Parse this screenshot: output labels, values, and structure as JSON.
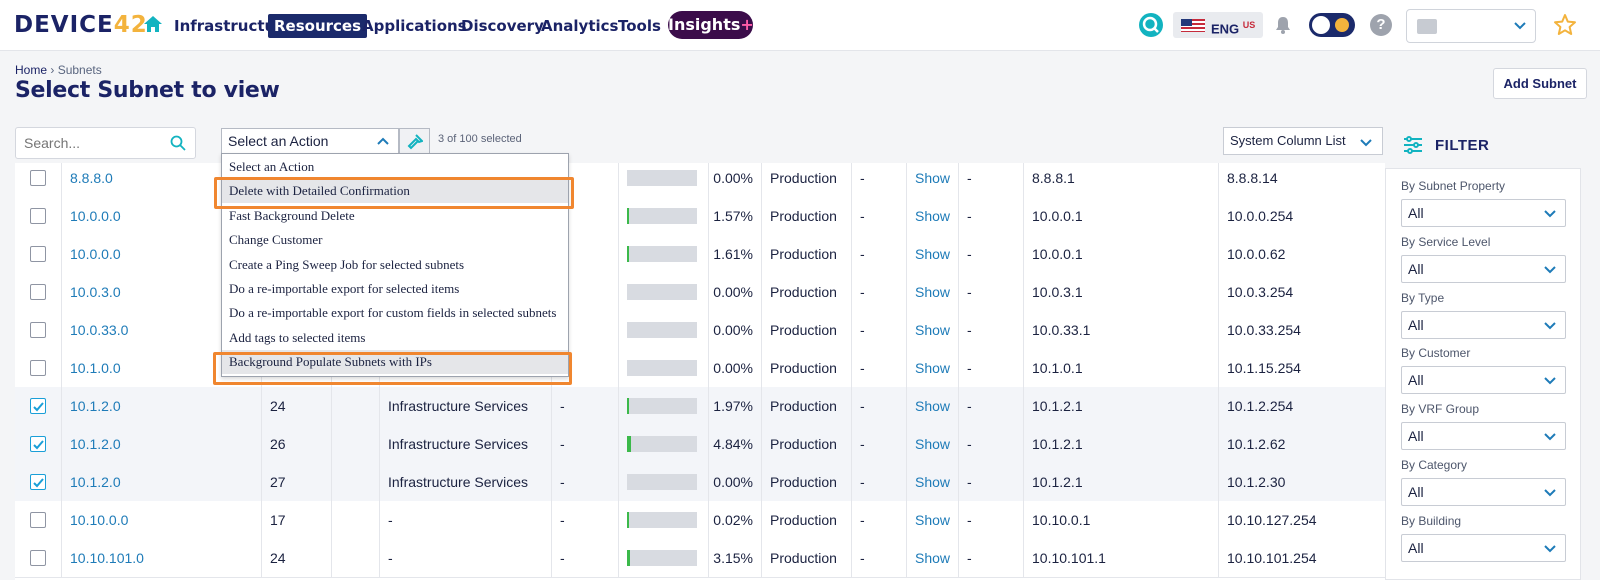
{
  "colors": {
    "brand_navy": "#1b2366",
    "accent_teal": "#12b3c0",
    "link_blue": "#1e7bb8",
    "highlight_orange": "#f0862f",
    "bar_green": "#3bb94a"
  },
  "nav": {
    "logo_text": "DEVICE",
    "logo_num": "42",
    "items": [
      "Infrastructure",
      "Resources",
      "Applications",
      "Discovery",
      "Analytics",
      "Tools"
    ],
    "active": "Resources",
    "insights_label": "Insights",
    "insights_plus": "+",
    "lang_label": "ENG",
    "lang_sup": "US",
    "help_glyph": "?"
  },
  "header": {
    "breadcrumb_home": "Home",
    "breadcrumb_sep": " › ",
    "breadcrumb_current": "Subnets",
    "title": "Select Subnet to view",
    "add_button": "Add Subnet"
  },
  "toolbar": {
    "search_placeholder": "Search...",
    "action_selected": "Select an Action",
    "selected_count": "3 of 100 selected",
    "column_list": "System Column List"
  },
  "action_menu": {
    "items": [
      "Select an Action",
      "Delete with Detailed Confirmation",
      "Fast Background Delete",
      "Change Customer",
      "Create a Ping Sweep Job for selected subnets",
      "Do a re-importable export for selected items",
      "Do a re-importable export for custom fields in selected subnets",
      "Add tags to selected items",
      "Background Populate Subnets with IPs"
    ],
    "highlighted": [
      "Delete with Detailed Confirmation",
      "Background Populate Subnets with IPs"
    ]
  },
  "table": {
    "rows": [
      {
        "checked": false,
        "network": "8.8.8.0",
        "mask": "",
        "service": "",
        "vrf": "",
        "pct": "0.00%",
        "pct_value": 0.0,
        "env": "Production",
        "col9": "-",
        "show": "Show",
        "col11": "-",
        "first_ip": "8.8.8.1",
        "last_ip": "8.8.8.14"
      },
      {
        "checked": false,
        "network": "10.0.0.0",
        "mask": "",
        "service": "",
        "vrf": "-",
        "pct": "1.57%",
        "pct_value": 1.57,
        "env": "Production",
        "col9": "-",
        "show": "Show",
        "col11": "-",
        "first_ip": "10.0.0.1",
        "last_ip": "10.0.0.254"
      },
      {
        "checked": false,
        "network": "10.0.0.0",
        "mask": "",
        "service": "",
        "vrf": "-",
        "pct": "1.61%",
        "pct_value": 1.61,
        "env": "Production",
        "col9": "-",
        "show": "Show",
        "col11": "-",
        "first_ip": "10.0.0.1",
        "last_ip": "10.0.0.62"
      },
      {
        "checked": false,
        "network": "10.0.3.0",
        "mask": "",
        "service": "",
        "vrf": "-",
        "pct": "0.00%",
        "pct_value": 0.0,
        "env": "Production",
        "col9": "-",
        "show": "Show",
        "col11": "-",
        "first_ip": "10.0.3.1",
        "last_ip": "10.0.3.254"
      },
      {
        "checked": false,
        "network": "10.0.33.0",
        "mask": "",
        "service": "",
        "vrf": "-",
        "pct": "0.00%",
        "pct_value": 0.0,
        "env": "Production",
        "col9": "-",
        "show": "Show",
        "col11": "-",
        "first_ip": "10.0.33.1",
        "last_ip": "10.0.33.254"
      },
      {
        "checked": false,
        "network": "10.1.0.0",
        "mask": "",
        "service": "",
        "vrf": "-",
        "pct": "0.00%",
        "pct_value": 0.0,
        "env": "Production",
        "col9": "-",
        "show": "Show",
        "col11": "-",
        "first_ip": "10.1.0.1",
        "last_ip": "10.1.15.254"
      },
      {
        "checked": true,
        "network": "10.1.2.0",
        "mask": "24",
        "service": "Infrastructure Services",
        "vrf": "-",
        "pct": "1.97%",
        "pct_value": 1.97,
        "env": "Production",
        "col9": "-",
        "show": "Show",
        "col11": "-",
        "first_ip": "10.1.2.1",
        "last_ip": "10.1.2.254"
      },
      {
        "checked": true,
        "network": "10.1.2.0",
        "mask": "26",
        "service": "Infrastructure Services",
        "vrf": "-",
        "pct": "4.84%",
        "pct_value": 4.84,
        "env": "Production",
        "col9": "-",
        "show": "Show",
        "col11": "-",
        "first_ip": "10.1.2.1",
        "last_ip": "10.1.2.62"
      },
      {
        "checked": true,
        "network": "10.1.2.0",
        "mask": "27",
        "service": "Infrastructure Services",
        "vrf": "-",
        "pct": "0.00%",
        "pct_value": 0.0,
        "env": "Production",
        "col9": "-",
        "show": "Show",
        "col11": "-",
        "first_ip": "10.1.2.1",
        "last_ip": "10.1.2.30"
      },
      {
        "checked": false,
        "network": "10.10.0.0",
        "mask": "17",
        "service": "-",
        "vrf": "-",
        "pct": "0.02%",
        "pct_value": 0.02,
        "env": "Production",
        "col9": "-",
        "show": "Show",
        "col11": "-",
        "first_ip": "10.10.0.1",
        "last_ip": "10.10.127.254"
      },
      {
        "checked": false,
        "network": "10.10.101.0",
        "mask": "24",
        "service": "-",
        "vrf": "-",
        "pct": "3.15%",
        "pct_value": 3.15,
        "env": "Production",
        "col9": "-",
        "show": "Show",
        "col11": "-",
        "first_ip": "10.10.101.1",
        "last_ip": "10.10.101.254"
      }
    ]
  },
  "filter": {
    "title": "FILTER",
    "groups": [
      {
        "label": "By Subnet Property",
        "value": "All"
      },
      {
        "label": "By Service Level",
        "value": "All"
      },
      {
        "label": "By Type",
        "value": "All"
      },
      {
        "label": "By Customer",
        "value": "All"
      },
      {
        "label": "By VRF Group",
        "value": "All"
      },
      {
        "label": "By Category",
        "value": "All"
      },
      {
        "label": "By Building",
        "value": "All"
      }
    ]
  }
}
